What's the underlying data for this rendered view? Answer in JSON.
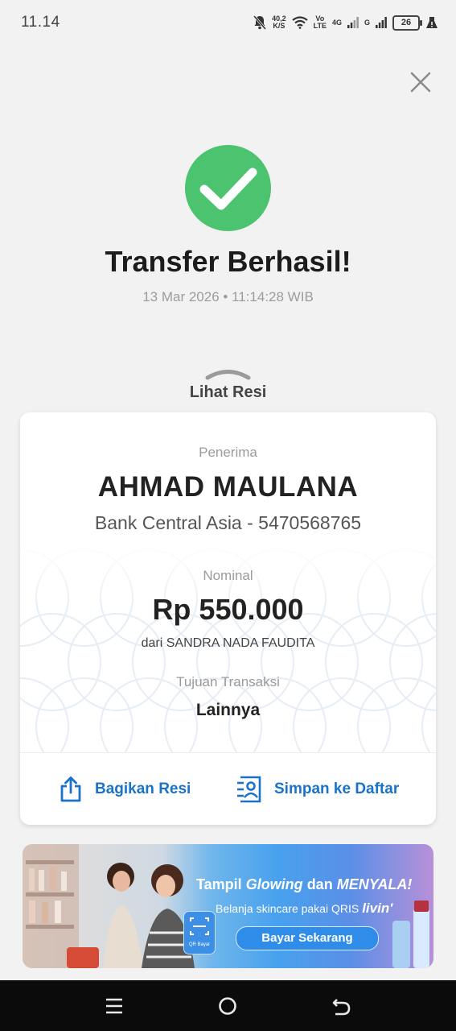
{
  "status_bar": {
    "time": "11.14",
    "net_speed_value": "40,2",
    "net_speed_unit": "K/S",
    "volte_line1": "Vo",
    "volte_line2": "LTE",
    "net_4g": "4G",
    "net_g": "G",
    "battery": "26"
  },
  "header": {
    "title": "Transfer Berhasil!",
    "datetime": "13 Mar 2026 • 11:14:28 WIB"
  },
  "receipt_toggle": {
    "label": "Lihat Resi"
  },
  "receipt": {
    "recipient_label": "Penerima",
    "recipient_name": "AHMAD MAULANA",
    "recipient_bank": "Bank Central Asia - 5470568765",
    "amount_label": "Nominal",
    "amount": "Rp 550.000",
    "from": "dari SANDRA NADA FAUDITA",
    "purpose_label": "Tujuan Transaksi",
    "purpose": "Lainnya"
  },
  "actions": {
    "share_label": "Bagikan Resi",
    "save_label": "Simpan ke Daftar"
  },
  "banner": {
    "headline_part1": "Tampil ",
    "headline_em": "Glowing",
    "headline_part2": " dan ",
    "headline_em2": "MENYALA!",
    "subtitle": "Belanja skincare pakai QRIS",
    "brand": "livin'",
    "qris_label": "QR Bayar",
    "cta": "Bayar Sekarang"
  },
  "colors": {
    "success": "#4cc46f",
    "accent": "#1a72c9",
    "background": "#f2f2f2"
  },
  "icons": {
    "close": "close-icon",
    "check": "check-icon",
    "chevron": "chevron-up-icon",
    "share": "share-icon",
    "save": "contact-save-icon",
    "nav_recent": "menu-icon",
    "nav_home": "home-icon",
    "nav_back": "back-icon"
  }
}
